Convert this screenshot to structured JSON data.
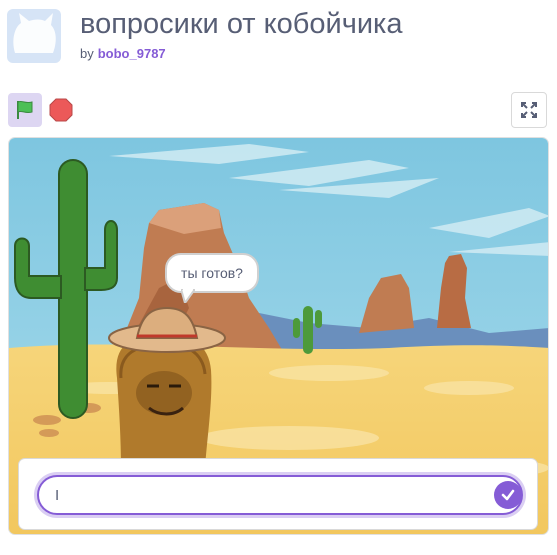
{
  "project": {
    "title": "вопросики от кобойчика",
    "by_label": "by",
    "author": "bobo_9787"
  },
  "controls": {
    "green_flag_icon": "green-flag-icon",
    "stop_icon": "stop-sign-icon",
    "fullscreen_icon": "fullscreen-icon"
  },
  "stage": {
    "speech_bubble": "ты готов?",
    "answer_value": "I",
    "submit_icon": "checkmark-icon"
  },
  "colors": {
    "accent": "#855cd6",
    "text": "#575e75",
    "flag_green": "#4cbf56",
    "stop_red": "#ec5959"
  }
}
